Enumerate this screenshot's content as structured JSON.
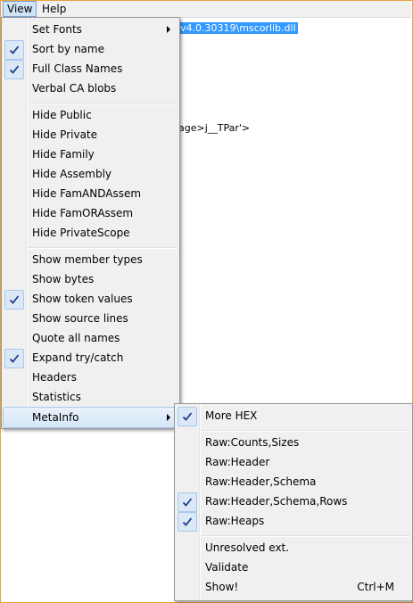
{
  "menubar": {
    "view": "View",
    "help": "Help"
  },
  "client": {
    "selected_path": "v4.0.30319\\mscorlib.dll",
    "partial_line": "age>j__TPar'>"
  },
  "view_menu": {
    "items": [
      {
        "label": "Set Fonts",
        "checked": false,
        "submenu": true
      },
      {
        "label": "Sort by name",
        "checked": true
      },
      {
        "label": "Full Class Names",
        "checked": true
      },
      {
        "label": "Verbal CA blobs",
        "checked": false
      },
      {
        "label": "Hide Public",
        "checked": false
      },
      {
        "label": "Hide Private",
        "checked": false
      },
      {
        "label": "Hide Family",
        "checked": false
      },
      {
        "label": "Hide Assembly",
        "checked": false
      },
      {
        "label": "Hide FamANDAssem",
        "checked": false
      },
      {
        "label": "Hide FamORAssem",
        "checked": false
      },
      {
        "label": "Hide PrivateScope",
        "checked": false
      },
      {
        "label": "Show member types",
        "checked": false
      },
      {
        "label": "Show bytes",
        "checked": false
      },
      {
        "label": "Show token values",
        "checked": true
      },
      {
        "label": "Show source lines",
        "checked": false
      },
      {
        "label": "Quote all names",
        "checked": false
      },
      {
        "label": "Expand try/catch",
        "checked": true
      },
      {
        "label": "Headers",
        "checked": false
      },
      {
        "label": "Statistics",
        "checked": false
      },
      {
        "label": "MetaInfo",
        "checked": false,
        "submenu": true,
        "highlighted": true
      }
    ]
  },
  "metainfo_menu": {
    "items": [
      {
        "label": "More HEX",
        "checked": true
      },
      {
        "label": "Raw:Counts,Sizes",
        "checked": false
      },
      {
        "label": "Raw:Header",
        "checked": false
      },
      {
        "label": "Raw:Header,Schema",
        "checked": false
      },
      {
        "label": "Raw:Header,Schema,Rows",
        "checked": true
      },
      {
        "label": "Raw:Heaps",
        "checked": true
      },
      {
        "label": "Unresolved ext.",
        "checked": false
      },
      {
        "label": "Validate",
        "checked": false
      },
      {
        "label": "Show!",
        "checked": false,
        "shortcut": "Ctrl+M"
      }
    ]
  },
  "icons": {
    "check": "checkmark-icon",
    "submenu": "submenu-arrow-icon"
  },
  "colors": {
    "accent_border": "#e8a33a",
    "selection": "#3399ff",
    "check_bg": "#dbe8f6"
  }
}
